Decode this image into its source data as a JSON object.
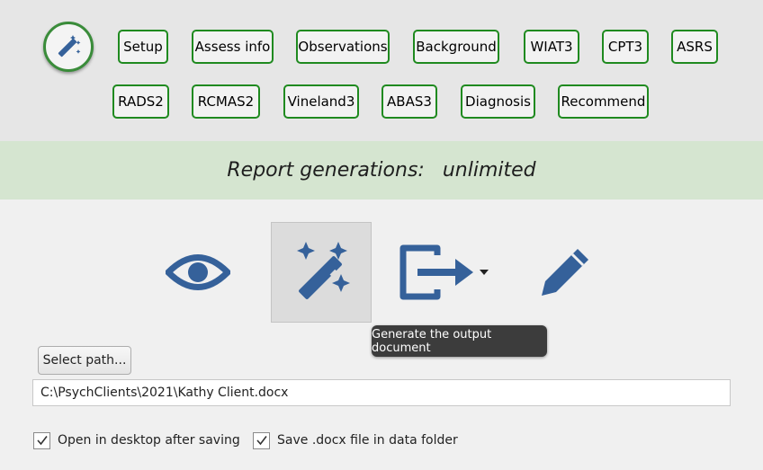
{
  "tabs_row1": [
    "Setup",
    "Assess info",
    "Observations",
    "Background",
    "WIAT3",
    "CPT3",
    "ASRS"
  ],
  "tabs_row2": [
    "RADS2",
    "RCMAS2",
    "Vineland3",
    "ABAS3",
    "Diagnosis",
    "Recommend"
  ],
  "banner": {
    "label": "Report generations:",
    "value": "unlimited"
  },
  "toolbar": {
    "icons": [
      "eye-icon",
      "magic-wand-icon",
      "export-icon",
      "pencil-icon"
    ],
    "tooltip": "Generate the output document"
  },
  "path": {
    "button_label": "Select path...",
    "value": "C:\\PsychClients\\2021\\Kathy Client.docx"
  },
  "options": {
    "open_desktop": {
      "label": "Open in desktop after saving",
      "checked": true
    },
    "save_docx": {
      "label": "Save .docx file in data folder",
      "checked": true
    }
  },
  "colors": {
    "accent_green": "#1f8a1f",
    "icon_blue": "#35619a",
    "banner_bg": "#d5e5d0"
  }
}
